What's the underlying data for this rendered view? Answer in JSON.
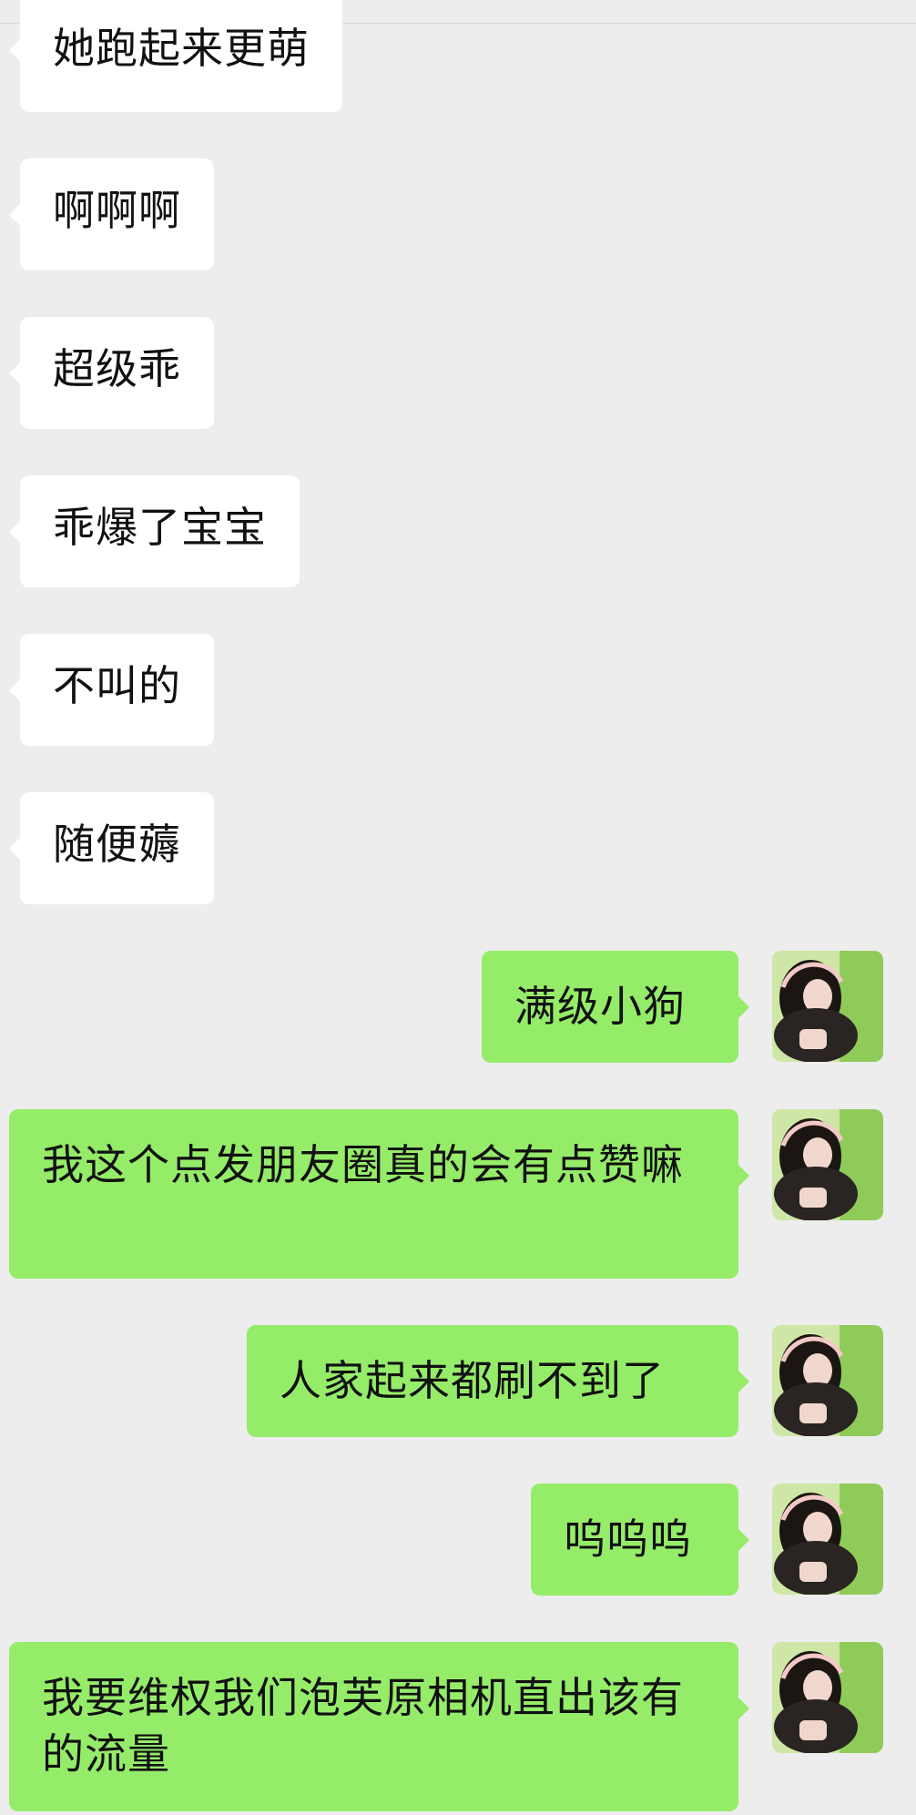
{
  "colors": {
    "background": "#ededed",
    "left_bubble": "#ffffff",
    "right_bubble": "#95ec69",
    "text": "#111111"
  },
  "messages": [
    {
      "side": "left",
      "text": "她跑起来更萌"
    },
    {
      "side": "left",
      "text": "啊啊啊"
    },
    {
      "side": "left",
      "text": "超级乖"
    },
    {
      "side": "left",
      "text": "乖爆了宝宝"
    },
    {
      "side": "left",
      "text": "不叫的"
    },
    {
      "side": "left",
      "text": "随便薅"
    },
    {
      "side": "right",
      "text": "满级小狗",
      "avatar": "user-avatar-icon"
    },
    {
      "side": "right",
      "text": "我这个点发朋友圈真的会有点赞嘛",
      "avatar": "user-avatar-icon"
    },
    {
      "side": "right",
      "text": "人家起来都刷不到了",
      "avatar": "user-avatar-icon"
    },
    {
      "side": "right",
      "text": "呜呜呜",
      "avatar": "user-avatar-icon"
    },
    {
      "side": "right",
      "text": "我要维权我们泡芙原相机直出该有的流量",
      "avatar": "user-avatar-icon"
    }
  ]
}
